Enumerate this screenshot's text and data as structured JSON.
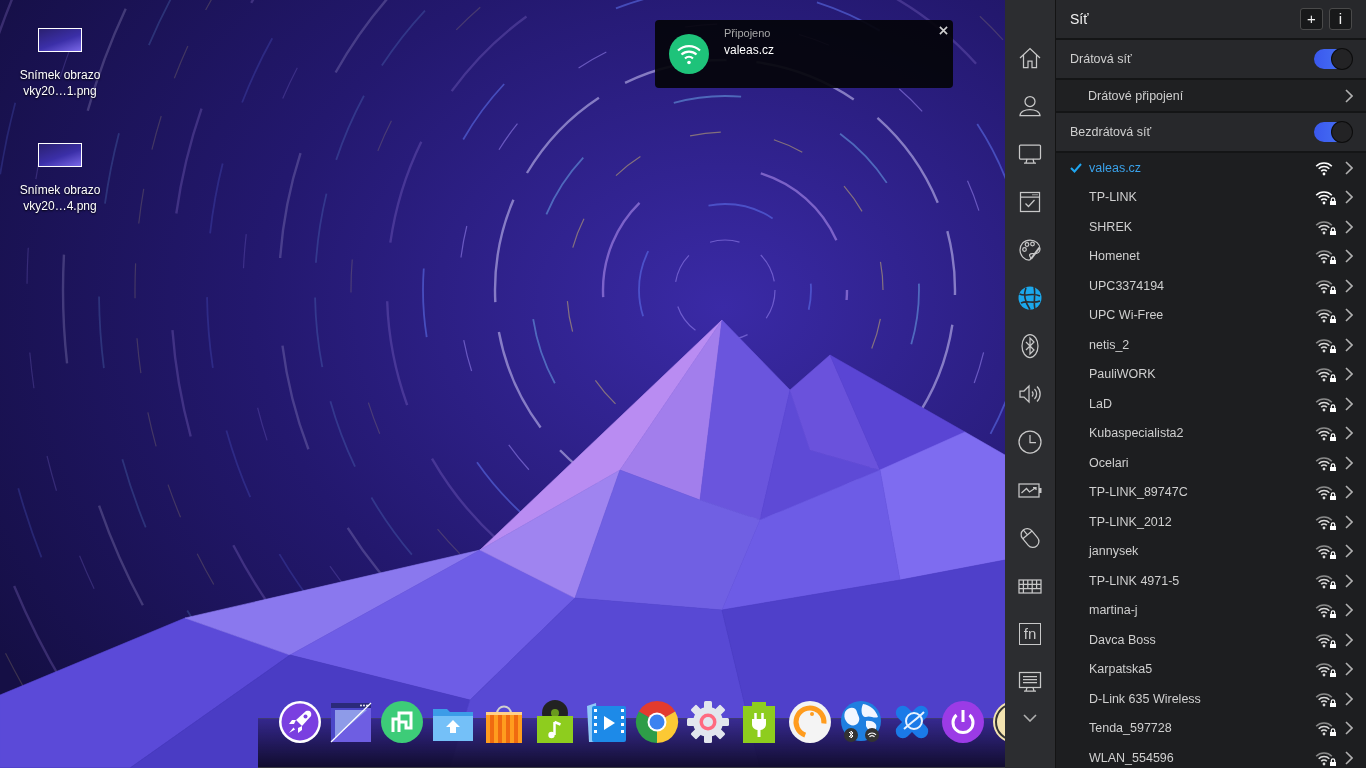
{
  "desktop": {
    "files": [
      {
        "label_lines": [
          "Snímek obrazo",
          "vky20…1.png"
        ]
      },
      {
        "label_lines": [
          "Snímek obrazo",
          "vky20…4.png"
        ]
      }
    ]
  },
  "notification": {
    "title": "Připojeno",
    "message": "valeas.cz"
  },
  "sidebar": {
    "items": [
      {
        "selected": false
      },
      {
        "selected": false
      },
      {
        "selected": false
      },
      {
        "selected": false
      },
      {
        "selected": false
      },
      {
        "selected": true
      },
      {
        "selected": false
      },
      {
        "selected": false
      },
      {
        "selected": false
      },
      {
        "selected": false
      },
      {
        "selected": false
      },
      {
        "selected": false
      },
      {
        "selected": false,
        "key_label": "fn"
      },
      {
        "selected": false
      }
    ]
  },
  "panel": {
    "title": "Síť",
    "header_buttons": [
      "+",
      "i"
    ],
    "wired": {
      "label": "Drátová síť",
      "on": true,
      "connections": [
        {
          "label": "Drátové připojení"
        }
      ]
    },
    "wireless": {
      "label": "Bezdrátová síť",
      "on": true,
      "networks": [
        {
          "name": "valeas.cz",
          "selected": true,
          "secured": false
        },
        {
          "name": "TP-LINK",
          "selected": false,
          "secured": true
        },
        {
          "name": "SHREK",
          "selected": false,
          "secured": true
        },
        {
          "name": "Homenet",
          "selected": false,
          "secured": true
        },
        {
          "name": "UPC3374194",
          "selected": false,
          "secured": true
        },
        {
          "name": "UPC Wi-Free",
          "selected": false,
          "secured": true
        },
        {
          "name": "netis_2",
          "selected": false,
          "secured": true
        },
        {
          "name": "PauliWORK",
          "selected": false,
          "secured": true
        },
        {
          "name": "LaD",
          "selected": false,
          "secured": true
        },
        {
          "name": "Kubaspecialista2",
          "selected": false,
          "secured": true
        },
        {
          "name": "Ocelari",
          "selected": false,
          "secured": true
        },
        {
          "name": "TP-LINK_89747C",
          "selected": false,
          "secured": true
        },
        {
          "name": "TP-LINK_2012",
          "selected": false,
          "secured": true
        },
        {
          "name": "jannysek",
          "selected": false,
          "secured": true
        },
        {
          "name": "TP-LINK 4971-5",
          "selected": false,
          "secured": true
        },
        {
          "name": "martina-j",
          "selected": false,
          "secured": true
        },
        {
          "name": "Davca Boss",
          "selected": false,
          "secured": true
        },
        {
          "name": "Karpatska5",
          "selected": false,
          "secured": true
        },
        {
          "name": "D-Link 635 Wireless",
          "selected": false,
          "secured": true
        },
        {
          "name": "Tenda_597728",
          "selected": false,
          "secured": true
        },
        {
          "name": "WLAN_554596",
          "selected": false,
          "secured": true
        }
      ]
    }
  }
}
